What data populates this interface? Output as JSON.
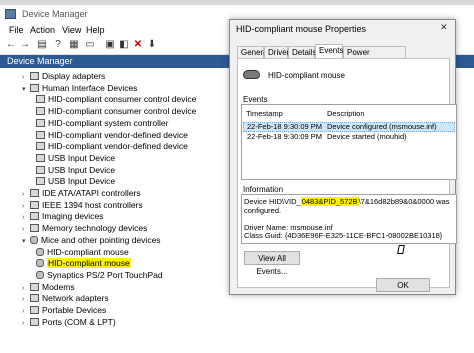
{
  "device_manager": {
    "title": "Device Manager",
    "menu": [
      "File",
      "Action",
      "View",
      "Help"
    ],
    "toolbar_icons": [
      "back-arrow-icon",
      "forward-arrow-icon",
      "properties-icon",
      "help-icon",
      "scan-icon",
      "monitor-icon",
      "update-driver-icon",
      "disable-icon",
      "uninstall-icon",
      "download-icon"
    ],
    "header": "Device Manager",
    "tree": [
      {
        "label": "Display adapters",
        "level": 1,
        "expanded": false
      },
      {
        "label": "Human Interface Devices",
        "level": 1,
        "expanded": true
      },
      {
        "label": "HID-compliant consumer control device",
        "level": 2
      },
      {
        "label": "HID-compliant consumer control device",
        "level": 2
      },
      {
        "label": "HID-compliant system controller",
        "level": 2
      },
      {
        "label": "HID-compliant vendor-defined device",
        "level": 2
      },
      {
        "label": "HID-compliant vendor-defined device",
        "level": 2
      },
      {
        "label": "USB Input Device",
        "level": 2
      },
      {
        "label": "USB Input Device",
        "level": 2
      },
      {
        "label": "USB Input Device",
        "level": 2
      },
      {
        "label": "IDE ATA/ATAPI controllers",
        "level": 1,
        "expanded": false
      },
      {
        "label": "IEEE 1394 host controllers",
        "level": 1,
        "expanded": false
      },
      {
        "label": "Imaging devices",
        "level": 1,
        "expanded": false
      },
      {
        "label": "Memory technology devices",
        "level": 1,
        "expanded": false
      },
      {
        "label": "Mice and other pointing devices",
        "level": 1,
        "expanded": true
      },
      {
        "label": "HID-compliant mouse",
        "level": 2
      },
      {
        "label": "HID-compliant mouse",
        "level": 2,
        "highlighted": true
      },
      {
        "label": "Synaptics PS/2 Port TouchPad",
        "level": 2
      },
      {
        "label": "Modems",
        "level": 1,
        "expanded": false
      },
      {
        "label": "Network adapters",
        "level": 1,
        "expanded": false
      },
      {
        "label": "Portable Devices",
        "level": 1,
        "expanded": false
      },
      {
        "label": "Ports (COM & LPT)",
        "level": 1,
        "expanded": false
      }
    ]
  },
  "dialog": {
    "title": "HID-compliant mouse Properties",
    "close_label": "✕",
    "tabs": [
      "General",
      "Driver",
      "Details",
      "Events",
      "Power Management"
    ],
    "active_tab": "Events",
    "device_name": "HID-compliant mouse",
    "events_label": "Events",
    "columns": [
      "Timestamp",
      "Description"
    ],
    "events": [
      {
        "timestamp": "22-Feb-18 9:30:09 PM",
        "description": "Device configured (msmouse.inf)"
      },
      {
        "timestamp": "22-Feb-18 9:30:09 PM",
        "description": "Device started (mouhid)"
      }
    ],
    "info_label": "Information",
    "info_line1_prefix": "Device HID\\VID_",
    "info_line1_highlight": "0483&PID_572B",
    "info_line1_suffix": "\\7&16d82b89&0&0000 was",
    "info_line2": "configured.",
    "info_line3": "Driver Name: msmouse.inf",
    "info_line4": "Class Guid: {4D36E96F-E325-11CE-BFC1-08002BE10318}",
    "view_all_button": "View All Events...",
    "ok_button": "OK"
  },
  "colors": {
    "header_bg": "#2b5a94",
    "highlight": "#fff200",
    "selection": "#cce8ff"
  }
}
